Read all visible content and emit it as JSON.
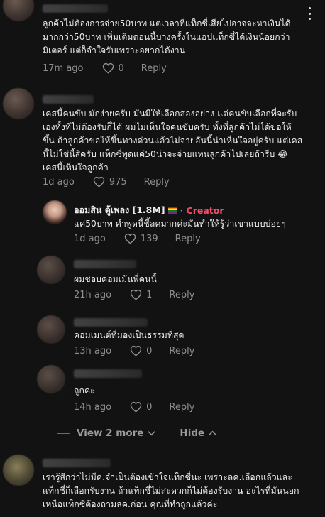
{
  "comments": [
    {
      "text": "ลูกค้าไม่ต้องการจ่าย50บาท แต่เวลาที่แท็กซี่เสียไปอาจจะหาเงินได้\nมากกว่า50บาท เพิ่มเติมตอนนี้บางครั้งในแอปแท็กซี่ได้เงินน้อยกว่า\nมิเตอร์ แต่ก็จำใจรับเพราะอยากได้งาน",
      "time": "17m ago",
      "likes": "0",
      "reply": "Reply"
    },
    {
      "text": "เคสนี้คนขับ มักง่ายครับ มันมีให้เลือกสองอย่าง แต่คนขับเลือกที่จะรับ\nเองทั้งที่ไม่ต้องรับก็ได้ ผมไม่เห็นใจคนขับครับ ทั้งที่ลูกค้าไม่ได้ขอให้\nขึ้น ถ้าลูกค้าขอให้ขึ้นทางด่วนแล้วไม่จ่ายอันนี้น่าเห็นใจอยู่ครับ แต่เคส\nนี้ไม่ใช่นี้สิครับ แท็กซี่พูดแค่50น่าจะจ่ายแทนลูกค้าไปเลยถ้ารีบ 😂\nเคสนี้เห็นใจลูกค้า",
      "time": "1d ago",
      "likes": "975",
      "reply": "Reply"
    },
    {
      "author": "ออมสิน ตู้เพลง [1.8M]",
      "separator": "·",
      "badge": "Creator",
      "text": "แค่50บาท คำพูดนี้ชี้ลคมากค่ะมันทำให้รู้ว่าเขาแบบบ่อยๆ",
      "time": "1d ago",
      "likes": "139",
      "reply": "Reply"
    },
    {
      "text": "ผมชอบคอมเม้นพี่คนนี้",
      "time": "21h ago",
      "likes": "1",
      "reply": "Reply"
    },
    {
      "text": "คอมเมนต์ที่มองเป็นธรรมที่สุด",
      "time": "13h ago",
      "likes": "0",
      "reply": "Reply"
    },
    {
      "text": "ถูกคะ",
      "time": "14h ago",
      "likes": "0",
      "reply": "Reply"
    },
    {
      "text": "เรารู้สึกว่าไม่มีค.จำเป็นต้องเข้าใจแท็กซี่นะ เพราะลค.เลือกแล้วและ\nแท็กซี่ก็เลือกรับงาน ถ้าแท็กซี่ไม่สะดวกก็ไม่ต้องรับงาน อะไรที่มันนอก\nเหนือแท็กซี่ต้องถามลค.ก่อน คุณที่ทำถูกแล้วค่ะ"
    }
  ],
  "replies_toggle": {
    "view_more": "View 2 more",
    "hide": "Hide"
  },
  "colors": {
    "background": "#121212",
    "creator_badge": "#f34f6b",
    "muted": "#8e8e8e"
  },
  "icons": {
    "like": "heart-outline-icon",
    "more": "more-vertical-icon",
    "chevron": "chevron-down-icon",
    "chevron_up": "chevron-up-icon"
  }
}
